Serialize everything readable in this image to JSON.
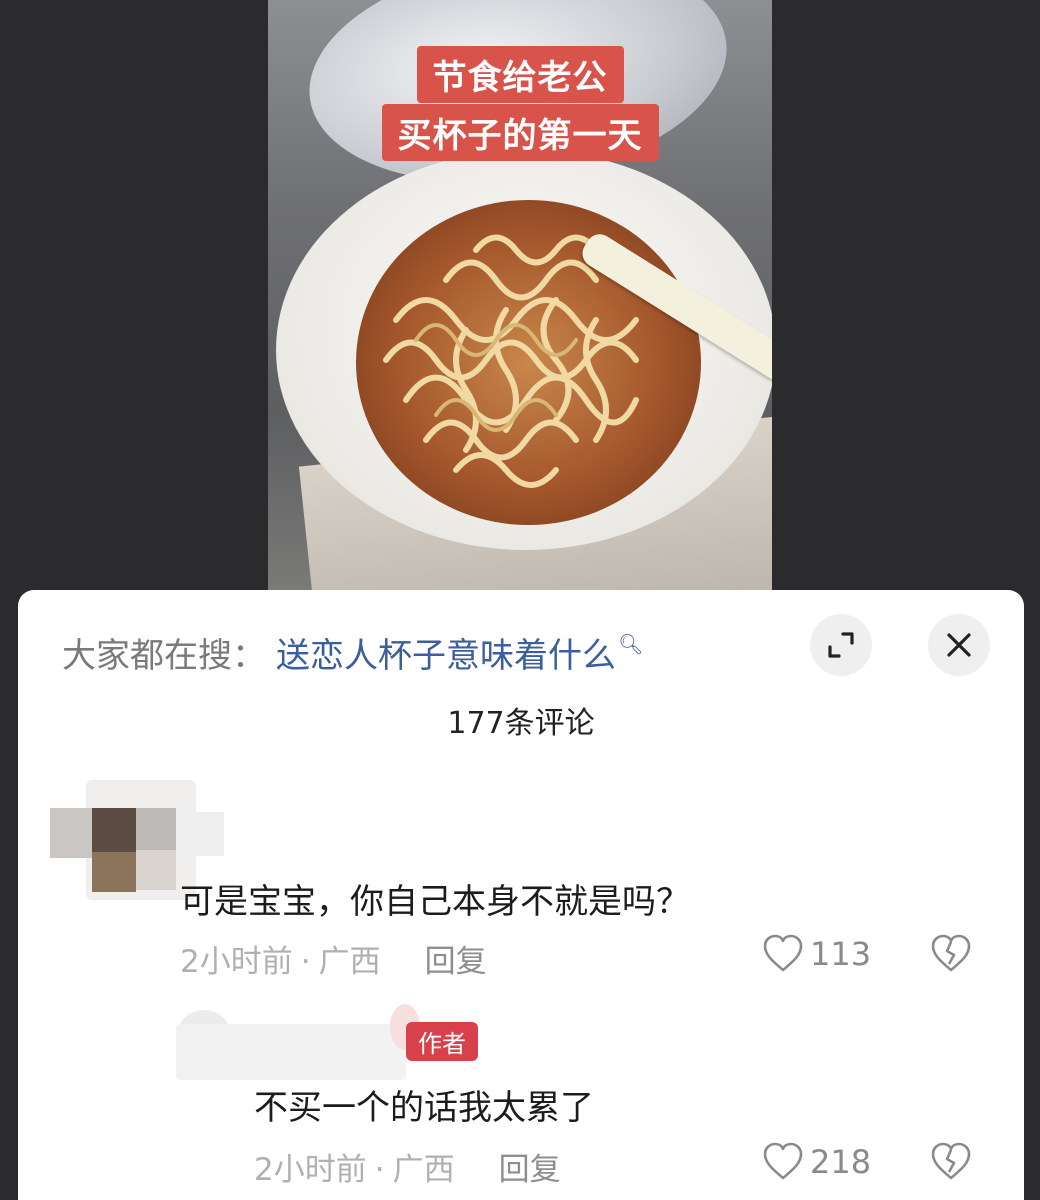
{
  "video": {
    "caption_line1": "节食给老公",
    "caption_line2": "买杯子的第一天"
  },
  "sheet": {
    "search_prefix": "大家都在搜：",
    "search_query": "送恋人杯子意味着什么",
    "search_icon": "search-icon",
    "expand_icon": "expand-icon",
    "close_icon": "close-icon",
    "comment_count_title": "177条评论"
  },
  "comments": [
    {
      "text": "可是宝宝，你自己本身不就是吗？",
      "time": "2小时前",
      "location": "广西",
      "reply_label": "回复",
      "likes": "113"
    },
    {
      "author_tag": "作者",
      "text": "不买一个的话我太累了",
      "time": "2小时前",
      "location": "广西",
      "reply_label": "回复",
      "likes": "218"
    }
  ],
  "colors": {
    "caption_bg": "#d8534a",
    "link": "#3b5e9c",
    "author_tag": "#d9414a"
  }
}
